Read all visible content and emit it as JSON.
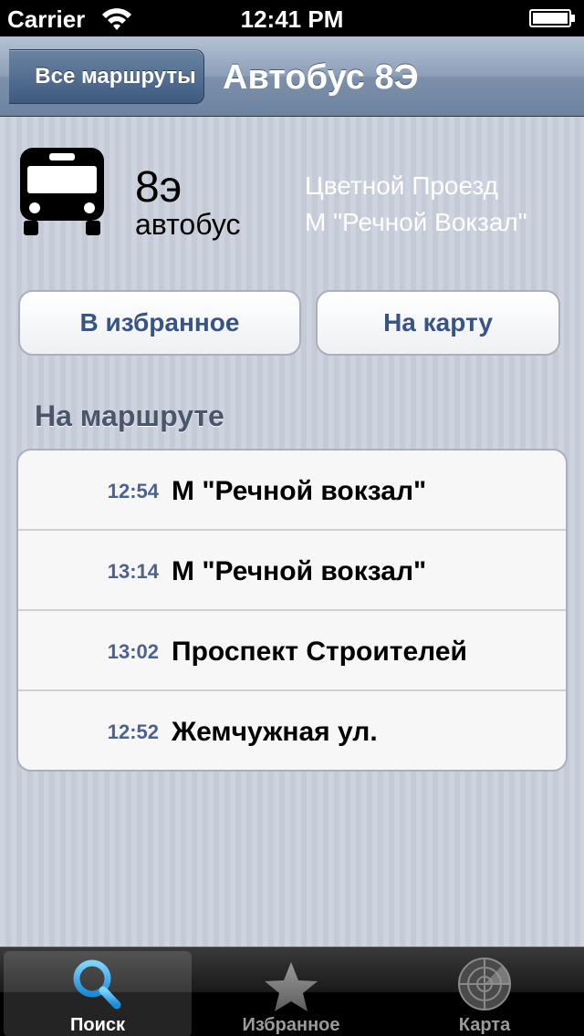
{
  "status_bar": {
    "carrier": "Carrier",
    "time": "12:41 PM"
  },
  "nav": {
    "back_label": "Все маршруты",
    "title": "Автобус 8Э"
  },
  "route": {
    "number": "8э",
    "type": "автобус",
    "stop_from": "Цветной Проезд",
    "stop_to": "М \"Речной Вокзал\"",
    "icon": "bus-icon"
  },
  "actions": {
    "favorite_label": "В избранное",
    "map_label": "На карту"
  },
  "section": {
    "title": "На маршруте"
  },
  "arrivals": [
    {
      "time": "12:54",
      "stop": "М \"Речной вокзал\""
    },
    {
      "time": "13:14",
      "stop": "М \"Речной вокзал\""
    },
    {
      "time": "13:02",
      "stop": "Проспект Строителей"
    },
    {
      "time": "12:52",
      "stop": "Жемчужная ул."
    }
  ],
  "tabs": [
    {
      "label": "Поиск",
      "icon": "search-icon",
      "active": true
    },
    {
      "label": "Избранное",
      "icon": "star-icon",
      "active": false
    },
    {
      "label": "Карта",
      "icon": "radar-icon",
      "active": false
    }
  ],
  "colors": {
    "accent_blue": "#385487",
    "time_blue": "#4c6290",
    "tab_active": "#2ea8e8"
  }
}
